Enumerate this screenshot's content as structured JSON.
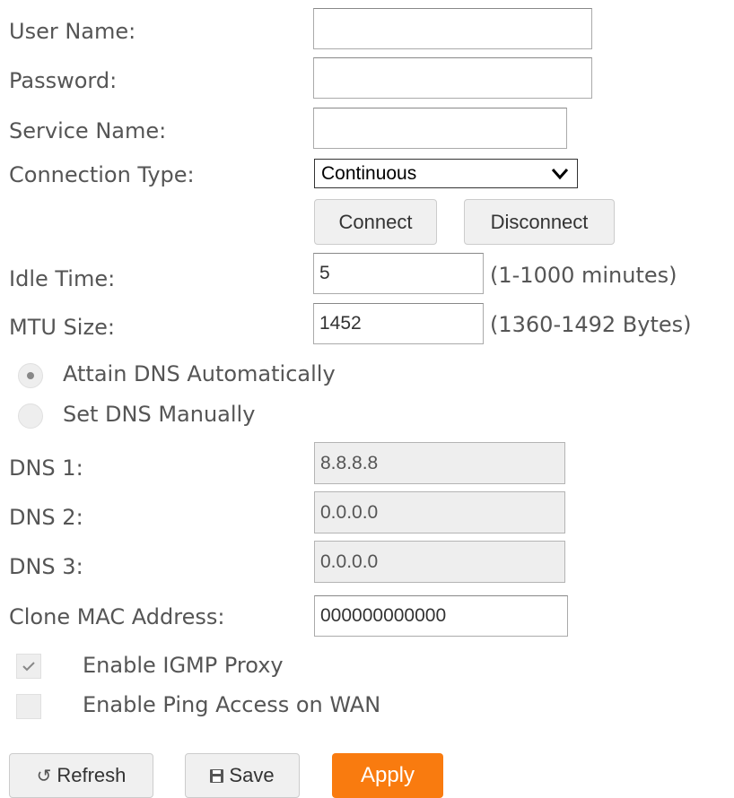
{
  "fields": {
    "user_name": {
      "label": "User Name:",
      "value": ""
    },
    "password": {
      "label": "Password:",
      "value": ""
    },
    "service_name": {
      "label": "Service Name:",
      "value": ""
    },
    "connection_type": {
      "label": "Connection Type:",
      "selected": "Continuous"
    },
    "idle_time": {
      "label": "Idle Time:",
      "value": "5",
      "hint": "(1-1000 minutes)"
    },
    "mtu_size": {
      "label": "MTU Size:",
      "value": "1452",
      "hint": "(1360-1492 Bytes)"
    },
    "dns1": {
      "label": "DNS 1:",
      "value": "8.8.8.8"
    },
    "dns2": {
      "label": "DNS 2:",
      "value": "0.0.0.0"
    },
    "dns3": {
      "label": "DNS 3:",
      "value": "0.0.0.0"
    },
    "clone_mac": {
      "label": "Clone MAC Address:",
      "value": "000000000000"
    }
  },
  "connection_buttons": {
    "connect": "Connect",
    "disconnect": "Disconnect"
  },
  "dns_mode": {
    "auto": {
      "label": "Attain DNS Automatically",
      "checked": true
    },
    "manual": {
      "label": "Set DNS Manually",
      "checked": false
    }
  },
  "options": {
    "igmp_proxy": {
      "label": "Enable IGMP Proxy",
      "checked": true
    },
    "ping_wan": {
      "label": "Enable Ping Access on WAN",
      "checked": false
    }
  },
  "footer": {
    "refresh": {
      "label": "Refresh",
      "icon": "refresh-icon"
    },
    "save": {
      "label": "Save",
      "icon": "save-icon"
    },
    "apply": {
      "label": "Apply"
    }
  },
  "colors": {
    "apply_button": "#f97b0f",
    "label_text": "#555555"
  }
}
